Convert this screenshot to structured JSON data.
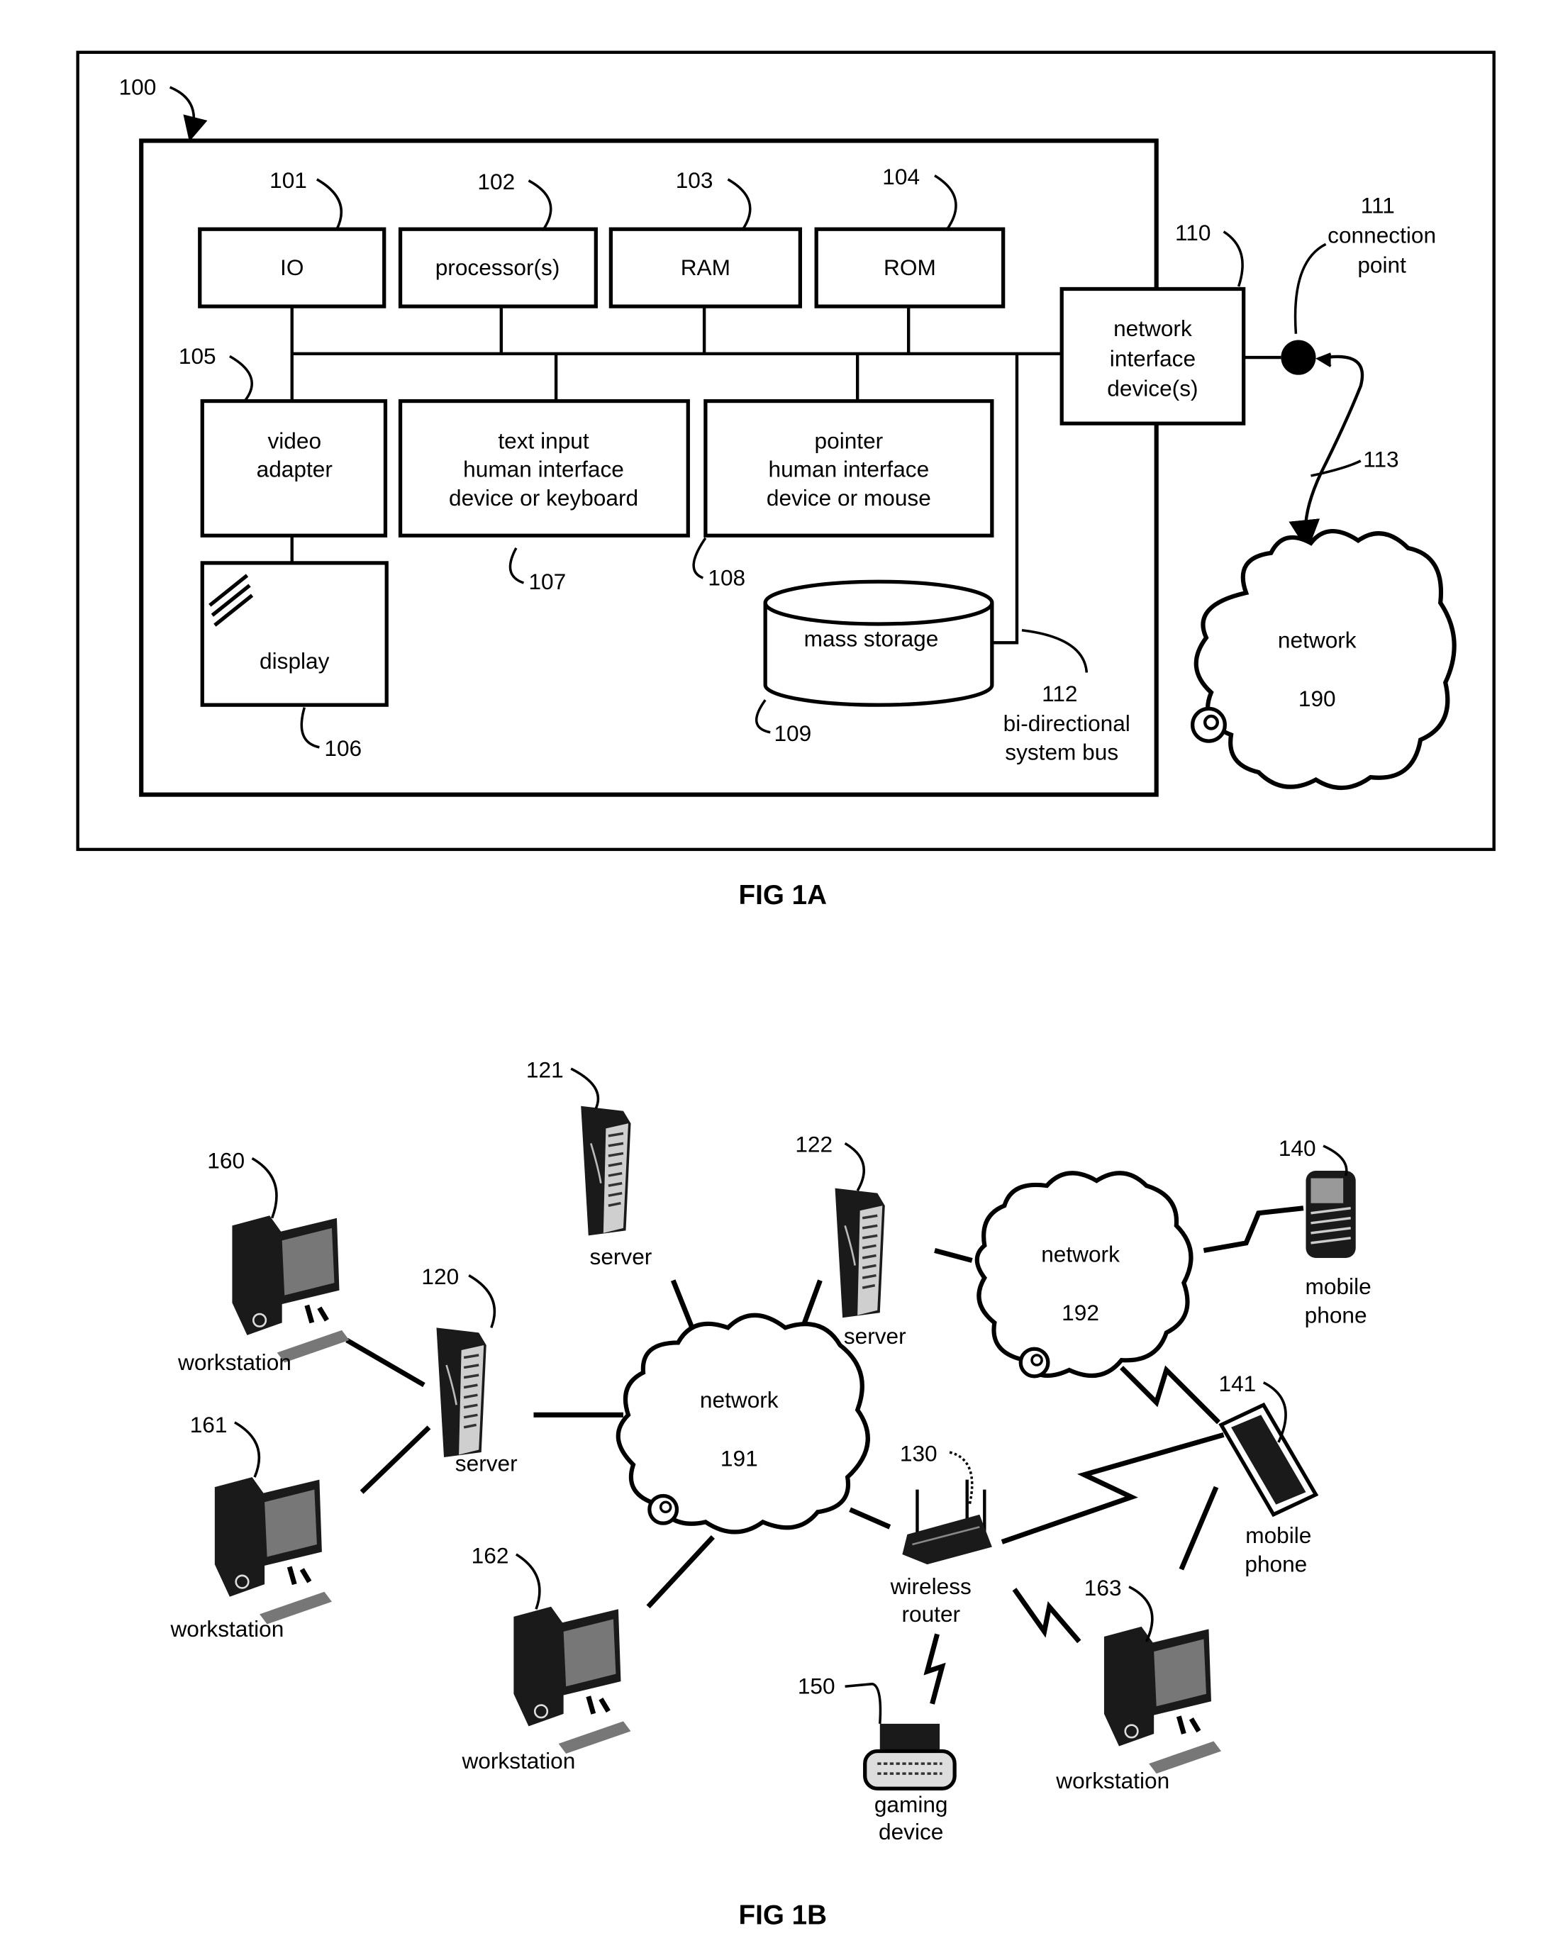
{
  "fig1a": {
    "caption": "FIG 1A",
    "system_ref": "100",
    "components": {
      "io": {
        "ref": "101",
        "label": "IO"
      },
      "processor": {
        "ref": "102",
        "label": "processor(s)"
      },
      "ram": {
        "ref": "103",
        "label": "RAM"
      },
      "rom": {
        "ref": "104",
        "label": "ROM"
      },
      "video_adapter": {
        "ref": "105",
        "lines": [
          "video",
          "adapter"
        ]
      },
      "display": {
        "ref": "106",
        "label": "display"
      },
      "keyboard": {
        "ref": "107",
        "lines": [
          "text input",
          "human interface",
          "device or keyboard"
        ]
      },
      "mouse": {
        "ref": "108",
        "lines": [
          "pointer",
          "human interface",
          "device or mouse"
        ]
      },
      "mass_storage": {
        "ref": "109",
        "label": "mass storage"
      },
      "nic": {
        "ref": "110",
        "lines": [
          "network",
          "interface",
          "device(s)"
        ]
      },
      "connection_point": {
        "ref": "111",
        "lines": [
          "connection",
          "point"
        ]
      },
      "bus": {
        "ref": "112",
        "lines": [
          "bi-directional",
          "system bus"
        ]
      },
      "link": {
        "ref": "113"
      },
      "network": {
        "ref": "190",
        "label": "network"
      }
    }
  },
  "fig1b": {
    "caption": "FIG 1B",
    "nodes": {
      "server120": {
        "ref": "120",
        "label": "server"
      },
      "server121": {
        "ref": "121",
        "label": "server"
      },
      "server122": {
        "ref": "122",
        "label": "server"
      },
      "router130": {
        "ref": "130",
        "lines": [
          "wireless",
          "router"
        ]
      },
      "phone140": {
        "ref": "140",
        "lines": [
          "mobile",
          "phone"
        ]
      },
      "phone141": {
        "ref": "141",
        "lines": [
          "mobile",
          "phone"
        ]
      },
      "gaming150": {
        "ref": "150",
        "lines": [
          "gaming",
          "device"
        ]
      },
      "ws160": {
        "ref": "160",
        "label": "workstation"
      },
      "ws161": {
        "ref": "161",
        "label": "workstation"
      },
      "ws162": {
        "ref": "162",
        "label": "workstation"
      },
      "ws163": {
        "ref": "163",
        "label": "workstation"
      },
      "net191": {
        "ref": "191",
        "label": "network"
      },
      "net192": {
        "ref": "192",
        "label": "network"
      }
    }
  }
}
